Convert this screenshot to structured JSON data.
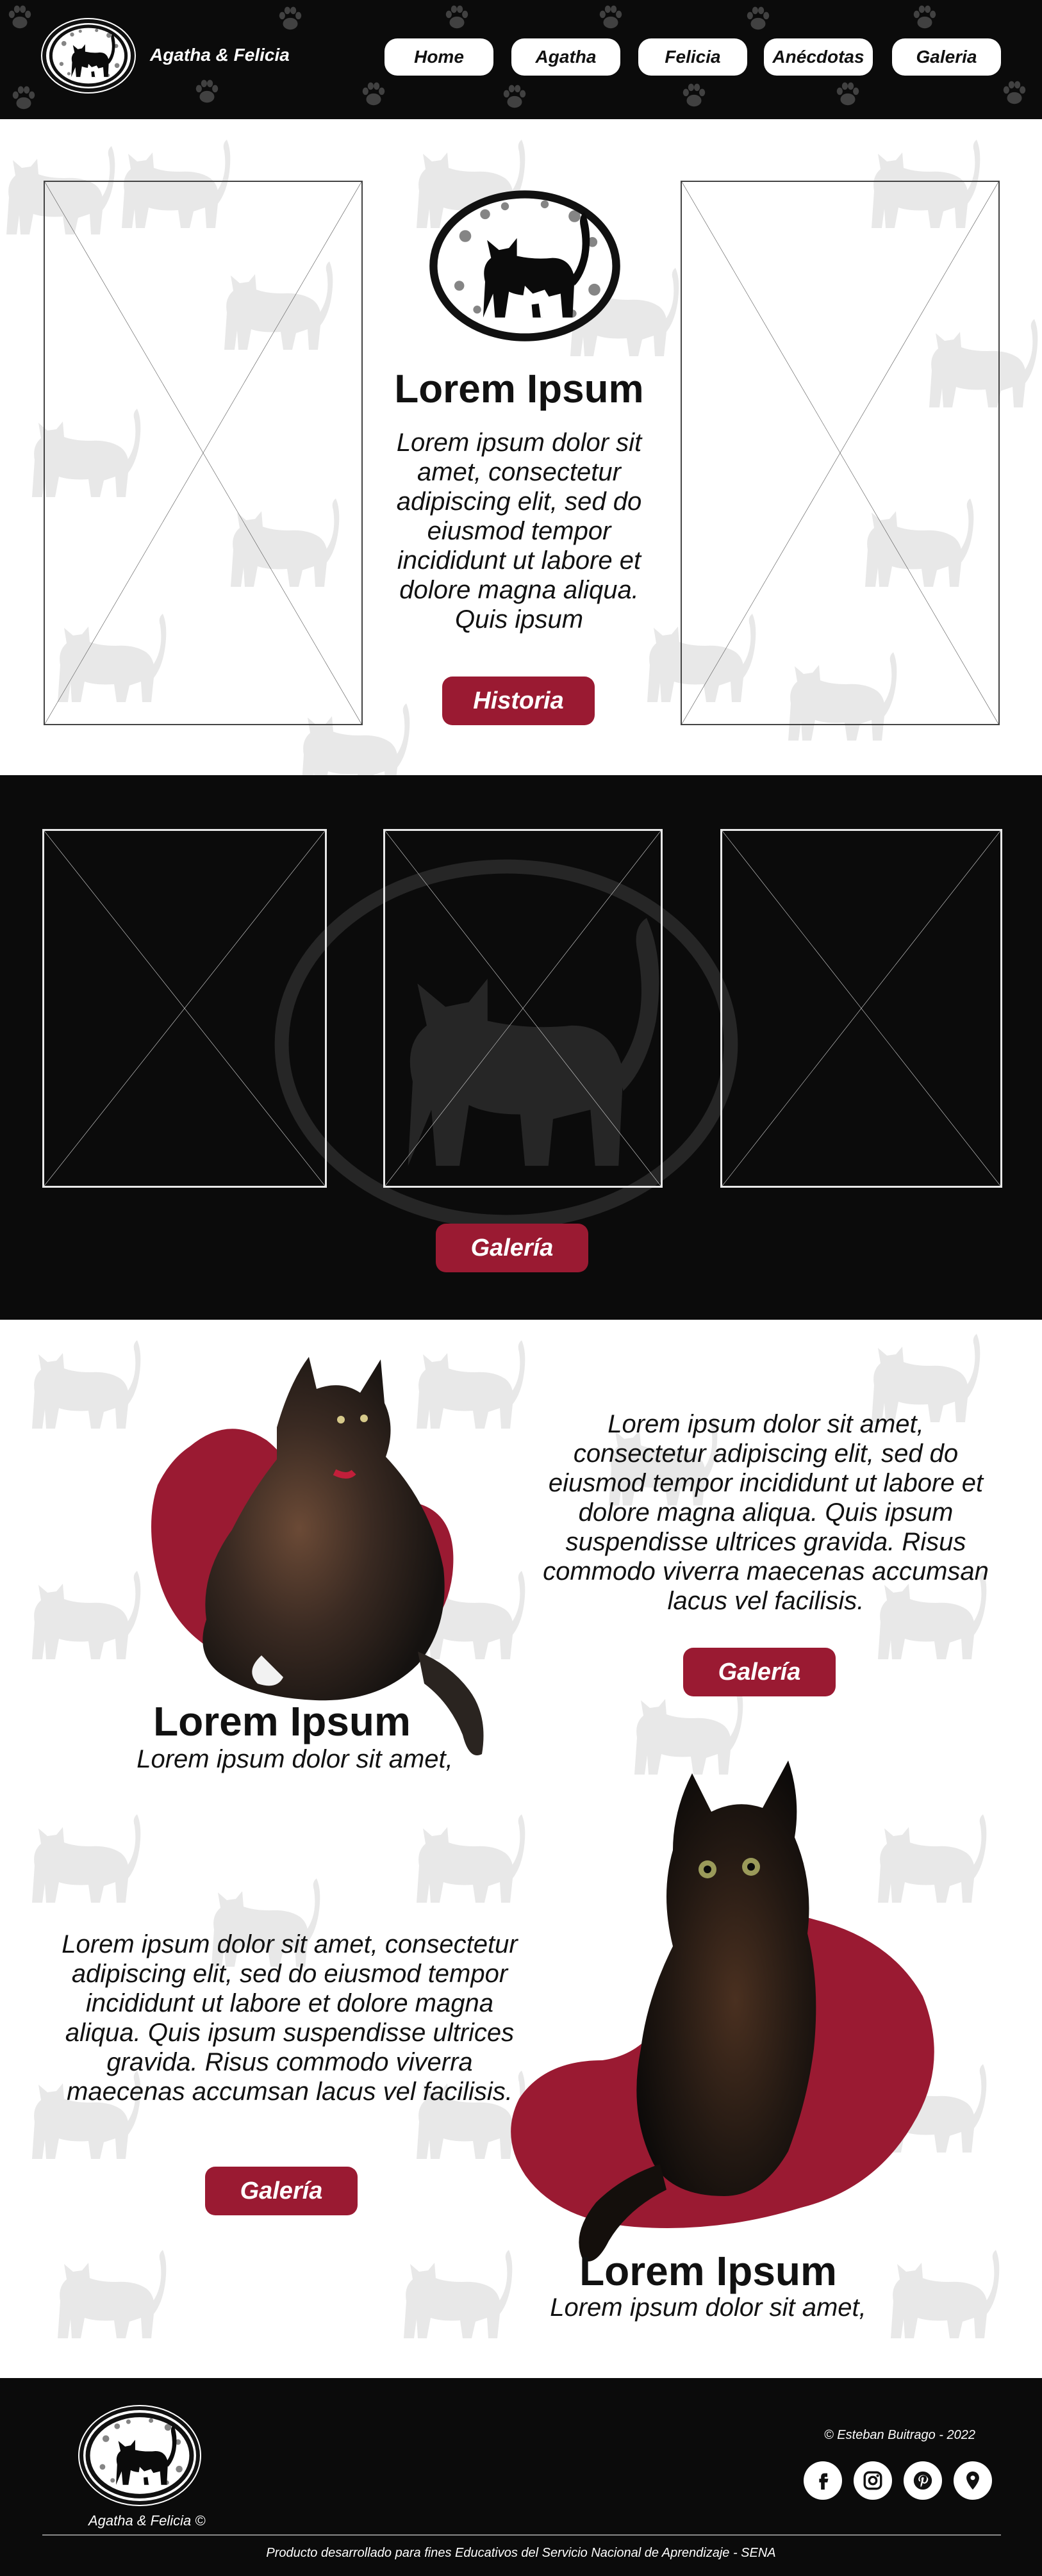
{
  "nav": {
    "brand": "Agatha & Felicia",
    "items": [
      "Home",
      "Agatha",
      "Felicia",
      "Anécdotas",
      "Galeria"
    ]
  },
  "hero": {
    "title": "Lorem Ipsum",
    "text": "Lorem ipsum dolor sit amet, consectetur adipiscing elit, sed do eiusmod tempor incididunt ut labore et dolore magna aliqua. Quis ipsum",
    "button": "Historia"
  },
  "gallery": {
    "button": "Galería"
  },
  "agatha": {
    "title": "Lorem Ipsum",
    "subtitle": "Lorem ipsum dolor sit amet,",
    "text": "Lorem ipsum dolor sit amet, consectetur adipiscing elit, sed do eiusmod tempor incididunt ut labore et dolore magna aliqua. Quis ipsum suspendisse ultrices gravida. Risus commodo viverra maecenas accumsan lacus vel facilisis.",
    "button": "Galería"
  },
  "felicia": {
    "title": "Lorem Ipsum",
    "subtitle": "Lorem ipsum dolor sit amet,",
    "text": "Lorem ipsum dolor sit amet, consectetur adipiscing elit, sed do eiusmod tempor incididunt ut labore et dolore magna aliqua. Quis ipsum suspendisse ultrices gravida. Risus commodo viverra maecenas accumsan lacus vel facilisis.",
    "button": "Galería"
  },
  "footer": {
    "brand": "Agatha & Felicia  ©",
    "copyright": "© Esteban Buitrago - 2022",
    "credit": "Producto desarrollado para fines Educativos del Servicio Nacional de Aprendizaje - SENA",
    "social": [
      "facebook-icon",
      "instagram-icon",
      "pinterest-icon",
      "location-pin-icon"
    ]
  },
  "colors": {
    "accent": "#9a1a32",
    "dark": "#0b0b0b",
    "light": "#ffffff"
  }
}
